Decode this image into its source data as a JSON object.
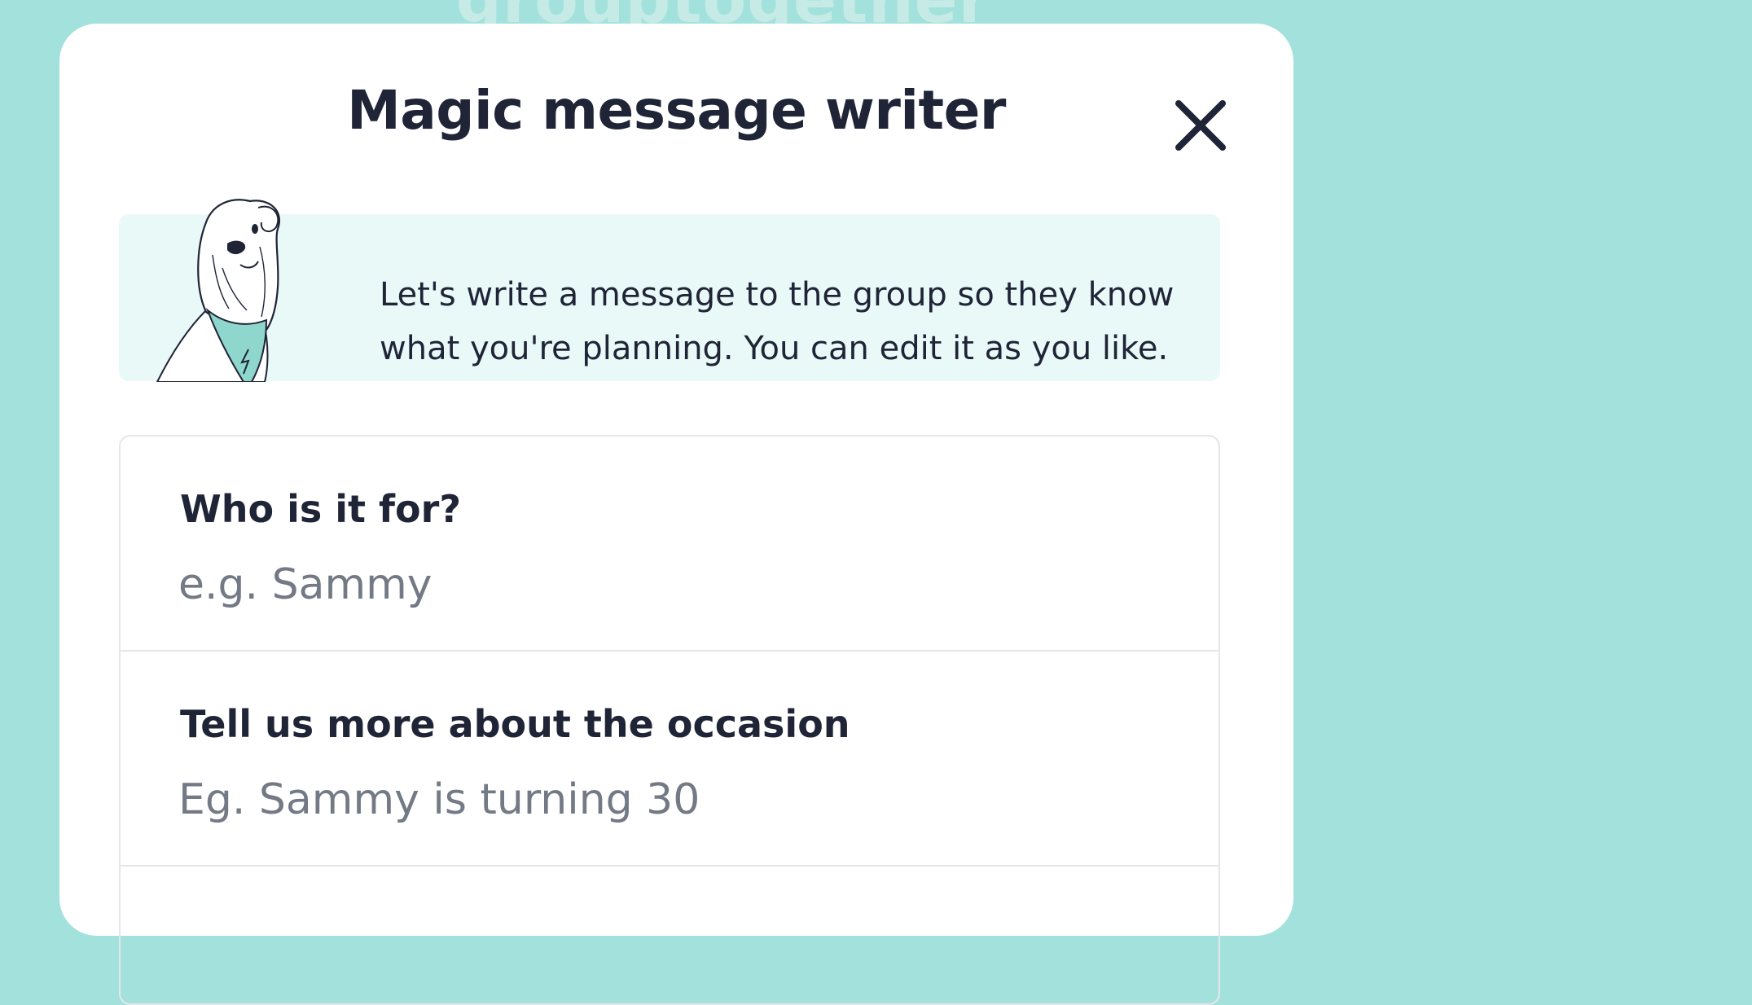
{
  "background": {
    "logo_text": "grouptogether",
    "color": "#a3e2dc"
  },
  "modal": {
    "title": "Magic message writer",
    "close_icon": "close-icon",
    "info": {
      "mascot_icon": "dog-mascot-illustration",
      "line1": "Let's write a message to the group so they know",
      "line2": "what you're planning. You can edit it as you like."
    },
    "fields": [
      {
        "label": "Who is it for?",
        "value": "",
        "placeholder": "e.g. Sammy"
      },
      {
        "label": "Tell us more about the occasion",
        "value": "",
        "placeholder": "Eg. Sammy is turning 30"
      }
    ]
  },
  "colors": {
    "accent": "#8fd6cd",
    "text": "#1f2437",
    "placeholder": "#737985",
    "info_bg": "#e9f9f8"
  }
}
